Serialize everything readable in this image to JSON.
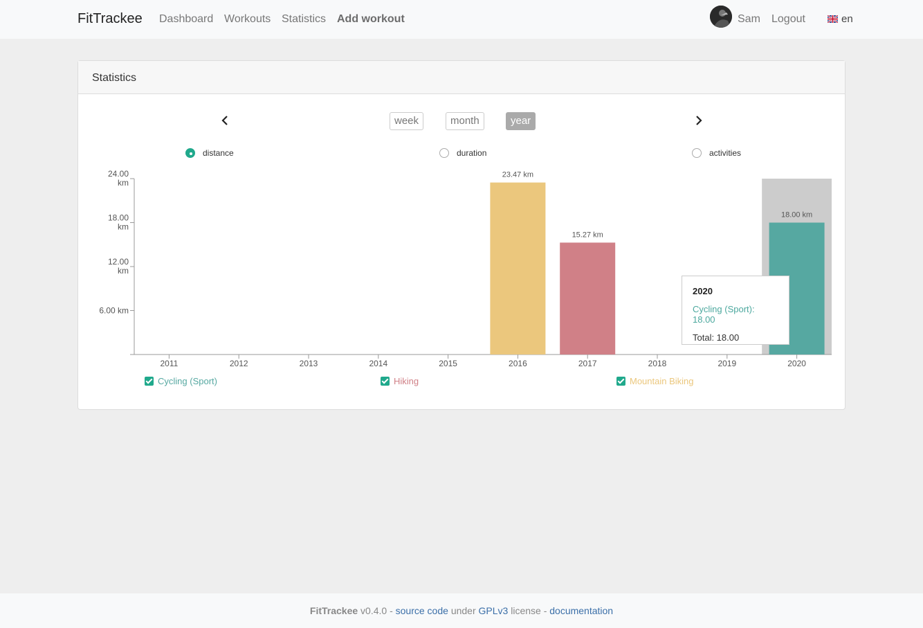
{
  "navbar": {
    "brand": "FitTrackee",
    "links": [
      "Dashboard",
      "Workouts",
      "Statistics",
      "Add workout"
    ],
    "user": "Sam",
    "logout": "Logout",
    "language": "en"
  },
  "card": {
    "title": "Statistics",
    "tabs": [
      "week",
      "month",
      "year"
    ],
    "active_tab": "year",
    "radios": [
      "distance",
      "duration",
      "activities"
    ],
    "selected_radio": "distance"
  },
  "chart_data": {
    "type": "bar",
    "stacked": true,
    "categories": [
      "2011",
      "2012",
      "2013",
      "2014",
      "2015",
      "2016",
      "2017",
      "2018",
      "2019",
      "2020"
    ],
    "series": [
      {
        "name": "Cycling (Sport)",
        "color": "#56a8a1",
        "values": [
          0,
          0,
          0,
          0,
          0,
          0,
          0,
          0,
          0,
          18.0
        ]
      },
      {
        "name": "Hiking",
        "color": "#d08087",
        "values": [
          0,
          0,
          0,
          0,
          0,
          0,
          15.27,
          0,
          0,
          0
        ]
      },
      {
        "name": "Mountain Biking",
        "color": "#ebc77d",
        "values": [
          0,
          0,
          0,
          0,
          0,
          23.47,
          0,
          0,
          0,
          0
        ]
      }
    ],
    "data_labels": [
      "",
      "",
      "",
      "",
      "",
      "23.47 km",
      "15.27 km",
      "",
      "",
      "18.00 km"
    ],
    "y_ticks": [
      {
        "value": 6,
        "line1": "6.00 km",
        "line2": ""
      },
      {
        "value": 12,
        "line1": "12.00",
        "line2": "km"
      },
      {
        "value": 18,
        "line1": "18.00",
        "line2": "km"
      },
      {
        "value": 24,
        "line1": "24.00",
        "line2": "km"
      }
    ],
    "ylim": [
      0,
      24
    ],
    "highlighted_category": "2020",
    "legend_placement": "bottom"
  },
  "tooltip": {
    "title": "2020",
    "line": "Cycling (Sport): 18.00",
    "total": "Total: 18.00"
  },
  "footer": {
    "brand": "FitTrackee",
    "version": "v0.4.0 -",
    "source": "source code",
    "under": "under",
    "license": "GPLv3",
    "license_word": "license -",
    "docs": "documentation"
  }
}
